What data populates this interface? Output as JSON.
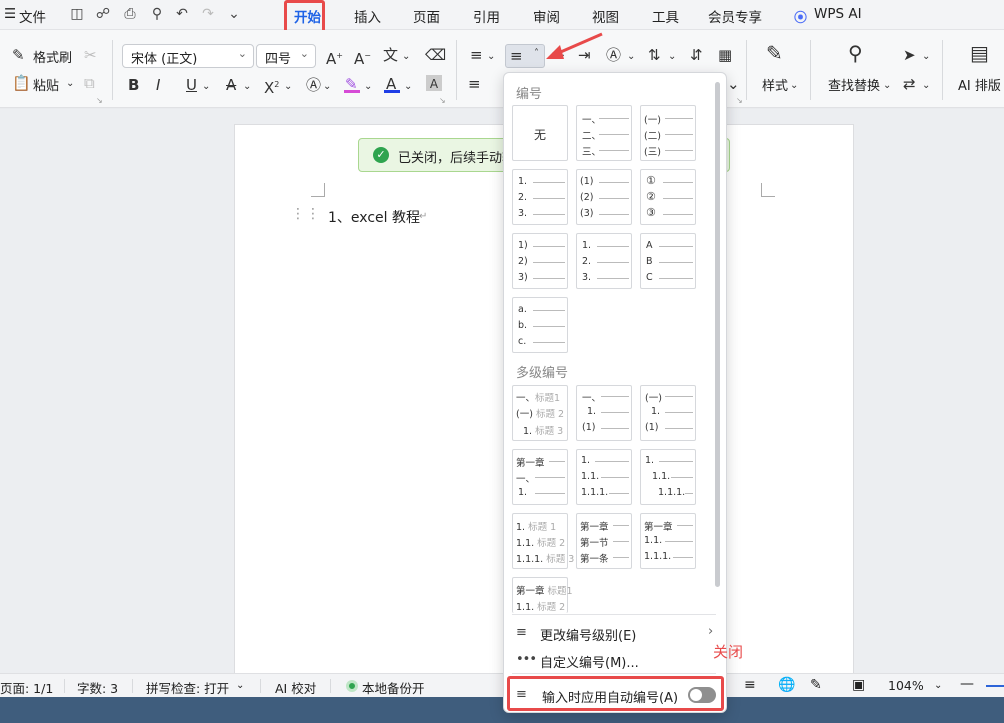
{
  "menubar": {
    "menu_icon": "☰",
    "file": "文件",
    "tabs": [
      "开始",
      "插入",
      "页面",
      "引用",
      "审阅",
      "视图",
      "工具",
      "会员专享"
    ],
    "wps_ai": "WPS AI"
  },
  "ribbon": {
    "format_painter": "格式刷",
    "paste": "粘贴",
    "font_name": "宋体 (正文)",
    "font_size": "四号",
    "style": "样式",
    "find_replace": "查找替换",
    "ai_layout": "AI 排版"
  },
  "toast": {
    "text": "已关闭，后续手动输"
  },
  "document": {
    "line": "1、excel 教程"
  },
  "dropdown": {
    "section_numbering": "编号",
    "none_label": "无",
    "section_multilevel": "多级编号",
    "change_level": "更改编号级别(E)",
    "custom_numbering": "自定义编号(M)...",
    "auto_numbering": "输入时应用自动编号(A)",
    "auto_numbering_on": false
  },
  "annotation": {
    "close_label": "关闭"
  },
  "status": {
    "page": "页面: 1/1",
    "words": "字数: 3",
    "spellcheck": "拼写检查: 打开",
    "ai_check": "AI 校对",
    "backup": "本地备份开",
    "zoom": "104%"
  },
  "colors": {
    "accent": "#1f63e6",
    "highlight_red": "#e84a4a",
    "toast_green": "#2fa44f"
  }
}
